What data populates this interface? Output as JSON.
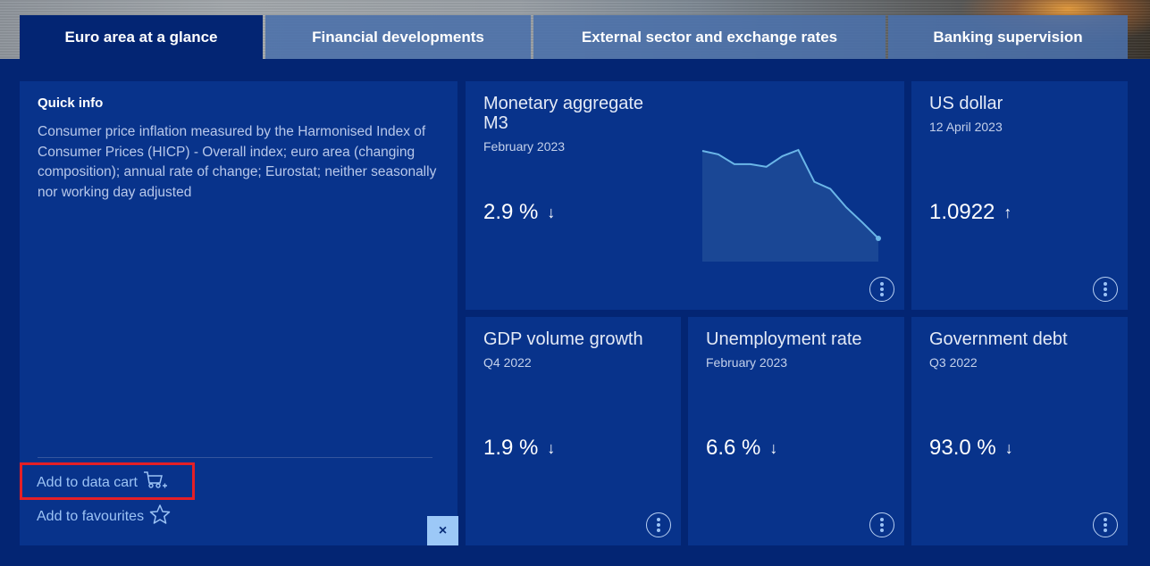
{
  "tabs": [
    {
      "label": "Euro area at a glance",
      "active": true
    },
    {
      "label": "Financial developments",
      "active": false
    },
    {
      "label": "External sector and exchange rates",
      "active": false
    },
    {
      "label": "Banking supervision",
      "active": false
    }
  ],
  "quick_info": {
    "title": "Quick info",
    "text": "Consumer price inflation measured by the Harmonised Index of Consumer Prices (HICP) - Overall index; euro area (changing composition); annual rate of change; Eurostat; neither seasonally nor working day adjusted",
    "add_to_cart": "Add to data cart",
    "add_to_favourites": "Add to favourites",
    "close_label": "×"
  },
  "cards": {
    "m3": {
      "title": "Monetary aggregate M3",
      "date": "February 2023",
      "value": "2.9 %",
      "trend": "↓"
    },
    "usd": {
      "title": "US dollar",
      "date": "12 April 2023",
      "value": "1.0922",
      "trend": "↑"
    },
    "gdp": {
      "title": "GDP volume growth",
      "date": "Q4 2022",
      "value": "1.9 %",
      "trend": "↓"
    },
    "unemp": {
      "title": "Unemployment rate",
      "date": "February 2023",
      "value": "6.6 %",
      "trend": "↓"
    },
    "debt": {
      "title": "Government debt",
      "date": "Q3 2022",
      "value": "93.0 %",
      "trend": "↓"
    }
  },
  "colors": {
    "background": "#032573",
    "panel": "#08338b",
    "accent": "#9cc3f5",
    "spark_line": "#6bb6e8",
    "highlight": "#e41f26"
  },
  "chart_data": {
    "type": "area",
    "title": "Monetary aggregate M3 (sparkline)",
    "xlabel": "",
    "ylabel": "",
    "note": "Relative trend values estimated from sparkline; no axis shown",
    "x": [
      1,
      2,
      3,
      4,
      5,
      6,
      7,
      8,
      9,
      10,
      11,
      12
    ],
    "values": [
      0.99,
      0.95,
      0.84,
      0.84,
      0.81,
      0.93,
      1.0,
      0.64,
      0.56,
      0.35,
      0.18,
      0.0
    ],
    "last_value_label": "2.9 %",
    "grid": false
  }
}
